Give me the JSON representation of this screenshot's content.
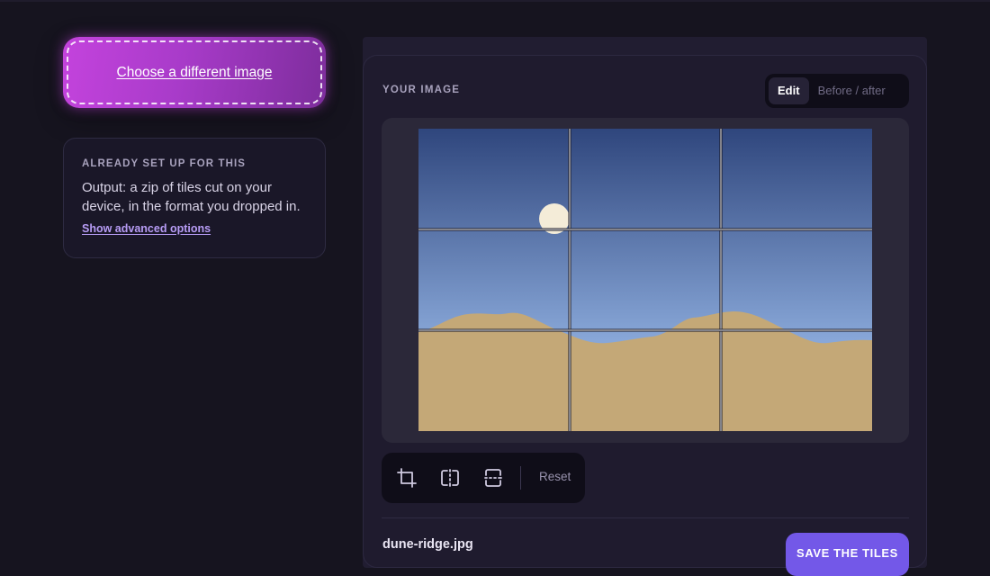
{
  "upload": {
    "label": "Choose a different image"
  },
  "info_card": {
    "eyebrow": "ALREADY SET UP FOR THIS",
    "body": "Output: a zip of tiles cut on your device, in the format you dropped in.",
    "link": "Show advanced options"
  },
  "panel": {
    "title": "YOUR IMAGE",
    "view_modes": [
      {
        "label": "Edit",
        "active": true
      },
      {
        "label": "Before / after",
        "active": false
      }
    ]
  },
  "image": {
    "grid": {
      "columns": 3,
      "rows": 3
    },
    "colors": {
      "sky_top": "#2f467d",
      "sky_bottom": "#88a7d8",
      "sand": "#c4a877",
      "sun": "#f4ecd8"
    }
  },
  "tools": {
    "icons": [
      "crop-icon",
      "split-vertical-icon",
      "split-horizontal-icon"
    ],
    "reset_label": "Reset"
  },
  "footer": {
    "filename": "dune-ridge.jpg",
    "save_label": "SAVE THE TILES"
  },
  "colors": {
    "accent": "#7358e8",
    "upload_gradient_start": "#c443dd",
    "upload_gradient_end": "#7d2d9c"
  }
}
